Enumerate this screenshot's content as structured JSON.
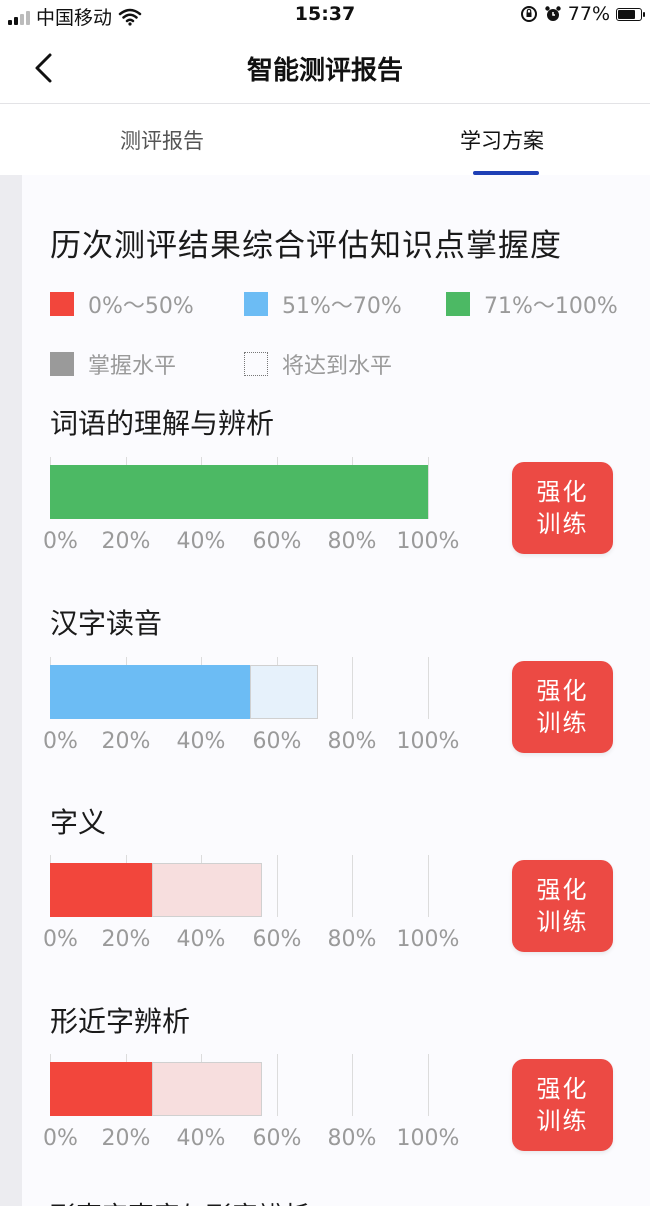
{
  "status_bar": {
    "carrier": "中国移动",
    "time": "15:37",
    "battery": "77%",
    "battery_level": 0.77
  },
  "nav": {
    "title": "智能测评报告"
  },
  "tabs": [
    {
      "label": "测评报告",
      "active": false
    },
    {
      "label": "学习方案",
      "active": true
    }
  ],
  "heading": "历次测评结果综合评估知识点掌握度",
  "legend": {
    "ranges": [
      {
        "label": "0%～50%",
        "color": "#f2463c"
      },
      {
        "label": "51%～70%",
        "color": "#6cbcf4"
      },
      {
        "label": "71%～100%",
        "color": "#4cb964"
      }
    ],
    "mastered_label": "掌握水平",
    "target_label": "将达到水平"
  },
  "axis_ticks": [
    "0%",
    "20%",
    "40%",
    "60%",
    "80%",
    "100%"
  ],
  "train_button": {
    "line1": "强化",
    "line2": "训练"
  },
  "knowledge_points": [
    {
      "title": "词语的理解与辨析",
      "mastered": 100,
      "target": 100,
      "color": "#4cb964",
      "target_color": "#e8f5ea"
    },
    {
      "title": "汉字读音",
      "mastered": 53,
      "target": 71,
      "color": "#6cbcf4",
      "target_color": "#e6f1fb"
    },
    {
      "title": "字义",
      "mastered": 27,
      "target": 56,
      "color": "#f2463c",
      "target_color": "#f7dede"
    },
    {
      "title": "形近字辨析",
      "mastered": 27,
      "target": 56,
      "color": "#f2463c",
      "target_color": "#f7dede"
    }
  ],
  "next_section_partial": "形声字声旁与形旁辨析"
}
